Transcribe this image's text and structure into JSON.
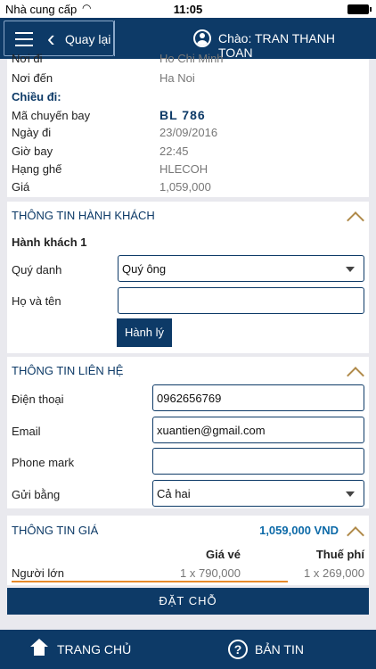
{
  "status_bar": {
    "carrier": "Nhà cung cấp",
    "time": "11:05"
  },
  "navbar": {
    "back_label": "Quay lại",
    "greeting": "Chào: TRAN THANH TOAN"
  },
  "flight": {
    "from_label": "Nơi đi",
    "from_value": "Ho Chi Minh",
    "to_label": "Nơi đến",
    "to_value": "Ha Noi",
    "direction_label": "Chiều đi:",
    "rows": [
      {
        "label": "Mã chuyến bay",
        "value": "BL  786"
      },
      {
        "label": "Ngày đi",
        "value": "23/09/2016"
      },
      {
        "label": "Giờ bay",
        "value": "22:45"
      },
      {
        "label": "Hạng ghế",
        "value": "HLECOH"
      },
      {
        "label": "Giá",
        "value": "1,059,000"
      }
    ]
  },
  "passenger": {
    "section_title": "THÔNG TIN HÀNH KHÁCH",
    "sub_title": "Hành khách 1",
    "title_label": "Quý danh",
    "title_value": "Quý ông",
    "name_label": "Họ và tên",
    "name_value": "",
    "baggage_button": "Hành lý"
  },
  "contact": {
    "section_title": "THÔNG TIN LIÊN HỆ",
    "phone_label": "Điện thoại",
    "phone_value": "0962656769",
    "email_label": "Email",
    "email_value": "xuantien@gmail.com",
    "phonemark_label": "Phone mark",
    "phonemark_value": "",
    "send_label": "Gửi bằng",
    "send_value": "Cả hai"
  },
  "price": {
    "section_title": "THÔNG TIN GIÁ",
    "total": "1,059,000 VND",
    "col_fare": "Giá vé",
    "col_tax": "Thuế phí",
    "row_label": "Người lớn",
    "fare_value": "1 x 790,000",
    "tax_value": "1 x 269,000"
  },
  "book_button": "ĐẶT CHỖ",
  "bottom_nav": {
    "home_label": "TRANG CHỦ",
    "news_label": "BẢN TIN"
  }
}
